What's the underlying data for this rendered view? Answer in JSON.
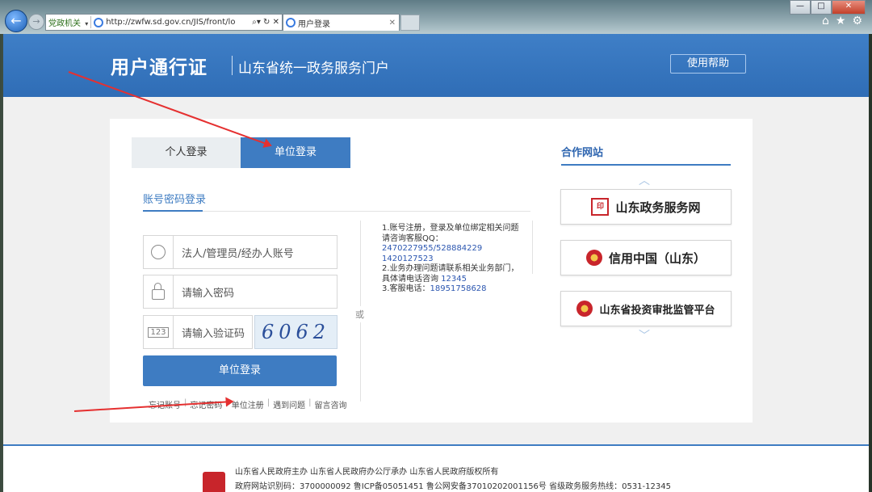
{
  "browser": {
    "favorite_label": "党政机关",
    "url": "http://zwfw.sd.gov.cn/JIS/front/lo",
    "tab_title": "用户登录",
    "window_controls": [
      "—",
      "□",
      "✕"
    ],
    "toolbar_icons": [
      "home-icon",
      "star-icon",
      "gear-icon"
    ]
  },
  "header": {
    "title": "用户通行证",
    "subtitle": "山东省统一政务服务门户",
    "help_label": "使用帮助"
  },
  "login": {
    "tab_personal": "个人登录",
    "tab_unit": "单位登录",
    "method": "账号密码登录",
    "account_placeholder": "法人/管理员/经办人账号",
    "password_placeholder": "请输入密码",
    "captcha_placeholder": "请输入验证码",
    "captcha_icon_text": "123",
    "captcha_text": "6062",
    "submit_label": "单位登录",
    "links": [
      "忘记账号",
      "忘记密码",
      "单位注册",
      "遇到问题",
      "留言咨询"
    ],
    "or_label": "或"
  },
  "notice": {
    "line1": "1.账号注册，登录及单位绑定相关问题请咨询客服QQ：",
    "qq1": "2470227955/528884229",
    "qq2": "1420127523",
    "line2": "2.业务办理问题请联系相关业务部门，具体请电话咨询",
    "phone1": "12345",
    "line3": "3.客服电话：",
    "phone2": "18951758628"
  },
  "partners": {
    "title": "合作网站",
    "items": [
      "山东政务服务网",
      "信用中国（山东）",
      "山东省投资审批监管平台"
    ]
  },
  "footer": {
    "line1": "山东省人民政府主办    山东省人民政府办公厅承办    山东省人民政府版权所有",
    "line2": "政府网站识别码：3700000092    鲁ICP备05051451    鲁公网安备37010202001156号    省级政务服务热线：0531-12345"
  },
  "colors": {
    "primary": "#3e7cc2",
    "annotation_arrow": "#e53030"
  }
}
